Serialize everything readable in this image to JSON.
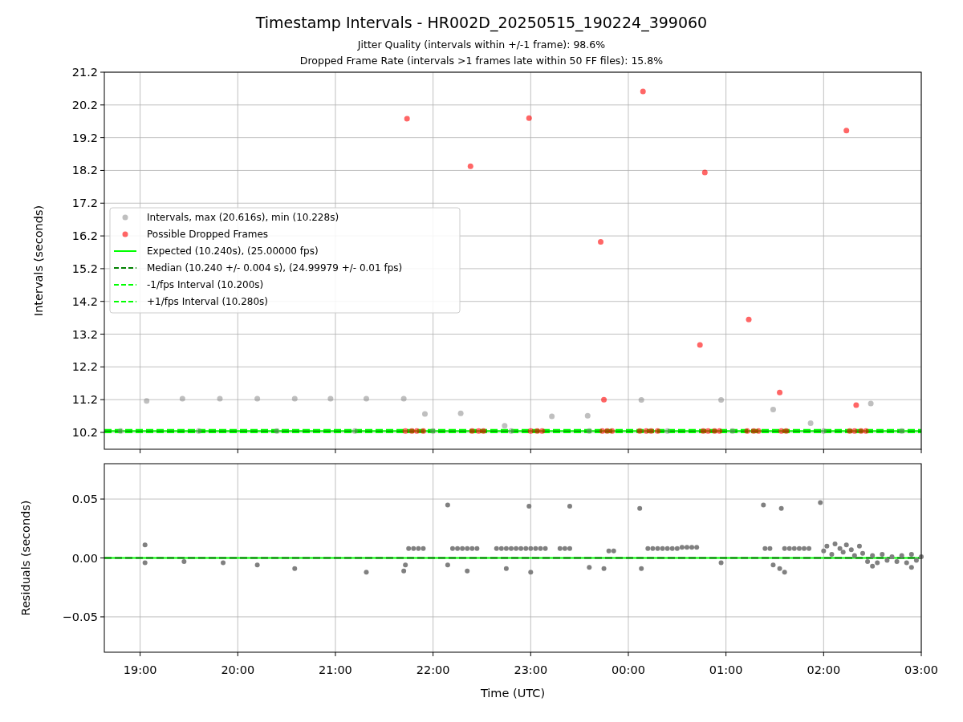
{
  "title": "Timestamp Intervals - HR002D_20250515_190224_399060",
  "subtitles": [
    "Jitter Quality (intervals within +/-1 frame): 98.6%",
    "Dropped Frame Rate (intervals >1 frames late within 50 FF files): 15.8%"
  ],
  "intervals_chart": {
    "chart_data": {
      "type": "scatter",
      "ylabel": "Intervals (seconds)",
      "grid": true,
      "xlim": [
        "2025-05-15 18:38",
        "2025-05-16 03:00"
      ],
      "ylim": [
        9.685,
        21.2
      ],
      "yticks": [
        {
          "value": 10.2,
          "label": "10.2"
        },
        {
          "value": 11.2,
          "label": "11.2"
        },
        {
          "value": 12.2,
          "label": "12.2"
        },
        {
          "value": 13.2,
          "label": "13.2"
        },
        {
          "value": 14.2,
          "label": "14.2"
        },
        {
          "value": 15.2,
          "label": "15.2"
        },
        {
          "value": 16.2,
          "label": "16.2"
        },
        {
          "value": 17.2,
          "label": "17.2"
        },
        {
          "value": 18.2,
          "label": "18.2"
        },
        {
          "value": 19.2,
          "label": "19.2"
        },
        {
          "value": 20.2,
          "label": "20.2"
        },
        {
          "value": 21.2,
          "label": "21.2"
        }
      ],
      "series": [
        {
          "name": "Intervals, max (20.616s), min (10.228s)",
          "color": "#808080",
          "x": [
            "2025-05-15 18:48",
            "2025-05-15 19:36",
            "2025-05-15 20:24",
            "2025-05-15 21:12",
            "2025-05-15 22:00",
            "2025-05-15 22:48",
            "2025-05-15 23:36",
            "2025-05-16 00:24",
            "2025-05-16 01:04",
            "2025-05-16 02:00",
            "2025-05-16 02:48",
            "2025-05-15 19:04",
            "2025-05-15 19:26",
            "2025-05-15 19:49",
            "2025-05-15 20:12",
            "2025-05-15 20:35",
            "2025-05-15 20:57",
            "2025-05-15 21:19",
            "2025-05-15 21:42",
            "2025-05-15 21:55",
            "2025-05-15 22:17",
            "2025-05-15 22:44",
            "2025-05-15 23:13",
            "2025-05-15 23:35",
            "2025-05-16 00:08",
            "2025-05-16 00:57",
            "2025-05-16 01:29",
            "2025-05-16 01:52",
            "2025-05-16 02:29"
          ],
          "values": [
            10.24,
            10.24,
            10.24,
            10.24,
            10.24,
            10.24,
            10.24,
            10.24,
            10.24,
            10.24,
            10.24,
            11.16,
            11.23,
            11.23,
            11.23,
            11.23,
            11.23,
            11.23,
            11.23,
            10.76,
            10.78,
            10.4,
            10.69,
            10.71,
            11.19,
            11.19,
            10.9,
            10.48,
            11.08
          ]
        },
        {
          "name": "Possible Dropped Frames",
          "color": "#ff0000",
          "x": [
            "2025-05-15 21:44",
            "2025-05-15 22:23",
            "2025-05-15 22:59",
            "2025-05-15 23:43",
            "2025-05-15 23:45",
            "2025-05-16 00:09",
            "2025-05-16 00:44",
            "2025-05-16 00:47",
            "2025-05-16 01:14",
            "2025-05-16 01:33",
            "2025-05-16 02:14",
            "2025-05-16 02:20",
            "2025-05-15 21:43",
            "2025-05-15 21:47",
            "2025-05-15 21:50",
            "2025-05-15 21:54",
            "2025-05-15 22:24",
            "2025-05-15 22:28",
            "2025-05-15 22:31",
            "2025-05-15 23:00",
            "2025-05-15 23:04",
            "2025-05-15 23:07",
            "2025-05-15 23:44",
            "2025-05-15 23:47",
            "2025-05-15 23:50",
            "2025-05-16 00:07",
            "2025-05-16 00:11",
            "2025-05-16 00:14",
            "2025-05-16 00:18",
            "2025-05-16 00:46",
            "2025-05-16 00:49",
            "2025-05-16 00:53",
            "2025-05-16 00:56",
            "2025-05-16 01:13",
            "2025-05-16 01:17",
            "2025-05-16 01:20",
            "2025-05-16 01:34",
            "2025-05-16 01:37",
            "2025-05-16 02:16",
            "2025-05-16 02:19",
            "2025-05-16 02:23",
            "2025-05-16 02:26"
          ],
          "values": [
            19.78,
            18.33,
            19.8,
            16.02,
            11.2,
            20.61,
            12.87,
            18.14,
            13.65,
            11.42,
            19.42,
            11.03,
            10.24,
            10.24,
            10.24,
            10.24,
            10.24,
            10.24,
            10.24,
            10.24,
            10.24,
            10.24,
            10.24,
            10.24,
            10.24,
            10.24,
            10.24,
            10.24,
            10.24,
            10.24,
            10.24,
            10.24,
            10.24,
            10.24,
            10.24,
            10.24,
            10.24,
            10.24,
            10.24,
            10.24,
            10.24,
            10.24
          ]
        }
      ],
      "ref_lines": [
        {
          "axis": "y",
          "value": 10.24,
          "label": "Expected (10.240s), (25.00000 fps)",
          "color": "#00ff00"
        },
        {
          "axis": "y",
          "value": 10.24,
          "label": "Median (10.240 +/- 0.004 s), (24.99979 +/- 0.01 fps)",
          "color": "#008000"
        },
        {
          "axis": "y",
          "value": 10.2,
          "label": "-1/fps Interval (10.200s)",
          "color": "#00ff00"
        },
        {
          "axis": "y",
          "value": 10.28,
          "label": "+1/fps Interval (10.280s)",
          "color": "#00ff00"
        }
      ],
      "legend": "center left"
    }
  },
  "residuals_chart": {
    "chart_data": {
      "type": "scatter",
      "xlabel": "Time (UTC)",
      "ylabel": "Residuals (seconds)",
      "grid": true,
      "xlim": [
        "2025-05-15 18:38",
        "2025-05-16 03:00"
      ],
      "ylim": [
        -0.08,
        0.08
      ],
      "xticks": [
        {
          "value": "2025-05-15 19:00",
          "label": "19:00"
        },
        {
          "value": "2025-05-15 20:00",
          "label": "20:00"
        },
        {
          "value": "2025-05-15 21:00",
          "label": "21:00"
        },
        {
          "value": "2025-05-15 22:00",
          "label": "22:00"
        },
        {
          "value": "2025-05-15 23:00",
          "label": "23:00"
        },
        {
          "value": "2025-05-16 00:00",
          "label": "00:00"
        },
        {
          "value": "2025-05-16 01:00",
          "label": "01:00"
        },
        {
          "value": "2025-05-16 02:00",
          "label": "02:00"
        },
        {
          "value": "2025-05-16 03:00",
          "label": "03:00"
        }
      ],
      "yticks": [
        {
          "value": -0.05,
          "label": "−0.05"
        },
        {
          "value": 0,
          "label": "0.00"
        },
        {
          "value": 0.05,
          "label": "0.05"
        }
      ],
      "series": [
        {
          "color": "#808080",
          "x": [
            "2025-05-15 19:03",
            "2025-05-15 19:03",
            "2025-05-15 19:27",
            "2025-05-15 19:51",
            "2025-05-15 20:12",
            "2025-05-15 20:35",
            "2025-05-15 21:19",
            "2025-05-15 21:42",
            "2025-05-15 21:43",
            "2025-05-15 21:45",
            "2025-05-15 21:48",
            "2025-05-15 21:51",
            "2025-05-15 21:54",
            "2025-05-15 22:12",
            "2025-05-15 22:15",
            "2025-05-15 22:18",
            "2025-05-15 22:21",
            "2025-05-15 22:24",
            "2025-05-15 22:27",
            "2025-05-15 22:39",
            "2025-05-15 22:42",
            "2025-05-15 22:45",
            "2025-05-15 22:48",
            "2025-05-15 22:51",
            "2025-05-15 22:54",
            "2025-05-15 22:57",
            "2025-05-15 23:00",
            "2025-05-15 23:03",
            "2025-05-15 23:06",
            "2025-05-15 23:09",
            "2025-05-15 23:18",
            "2025-05-15 23:21",
            "2025-05-15 23:24",
            "2025-05-15 23:48",
            "2025-05-15 23:51",
            "2025-05-16 00:12",
            "2025-05-16 00:15",
            "2025-05-16 00:18",
            "2025-05-16 00:21",
            "2025-05-16 00:24",
            "2025-05-16 00:27",
            "2025-05-16 00:30",
            "2025-05-16 00:33",
            "2025-05-16 00:36",
            "2025-05-16 00:39",
            "2025-05-16 00:42",
            "2025-05-16 01:24",
            "2025-05-16 01:27",
            "2025-05-16 01:36",
            "2025-05-16 01:39",
            "2025-05-16 01:42",
            "2025-05-16 01:45",
            "2025-05-16 01:48",
            "2025-05-16 01:51",
            "2025-05-16 02:00",
            "2025-05-16 02:02",
            "2025-05-16 02:05",
            "2025-05-16 02:07",
            "2025-05-16 02:10",
            "2025-05-16 02:12",
            "2025-05-16 02:14",
            "2025-05-16 02:17",
            "2025-05-16 02:19",
            "2025-05-16 02:22",
            "2025-05-16 02:24",
            "2025-05-16 02:27",
            "2025-05-16 02:30",
            "2025-05-16 02:33",
            "2025-05-16 02:36",
            "2025-05-16 02:39",
            "2025-05-16 02:42",
            "2025-05-16 02:45",
            "2025-05-16 02:48",
            "2025-05-16 02:51",
            "2025-05-16 02:54",
            "2025-05-16 02:57",
            "2025-05-16 03:00",
            "2025-05-15 22:09",
            "2025-05-15 22:21",
            "2025-05-15 22:45",
            "2025-05-15 23:00",
            "2025-05-15 23:36",
            "2025-05-15 23:45",
            "2025-05-16 00:08",
            "2025-05-16 00:57",
            "2025-05-16 01:29",
            "2025-05-16 01:36",
            "2025-05-16 01:33",
            "2025-05-16 02:30",
            "2025-05-16 02:54",
            "2025-05-15 22:09",
            "2025-05-15 22:59",
            "2025-05-15 23:24",
            "2025-05-16 00:07",
            "2025-05-16 01:23",
            "2025-05-16 01:34",
            "2025-05-16 01:58"
          ],
          "values": [
            0.011,
            -0.004,
            -0.003,
            -0.004,
            -0.006,
            -0.009,
            -0.012,
            -0.011,
            -0.006,
            0.008,
            0.008,
            0.008,
            0.008,
            0.008,
            0.008,
            0.008,
            0.008,
            0.008,
            0.008,
            0.008,
            0.008,
            0.008,
            0.008,
            0.008,
            0.008,
            0.008,
            0.008,
            0.008,
            0.008,
            0.008,
            0.008,
            0.008,
            0.008,
            0.006,
            0.006,
            0.008,
            0.008,
            0.008,
            0.008,
            0.008,
            0.008,
            0.008,
            0.009,
            0.009,
            0.009,
            0.009,
            0.008,
            0.008,
            0.008,
            0.008,
            0.008,
            0.008,
            0.008,
            0.008,
            0.006,
            0.01,
            0.003,
            0.012,
            0.008,
            0.005,
            0.011,
            0.007,
            0.002,
            0.01,
            0.004,
            -0.003,
            0.002,
            -0.004,
            0.003,
            -0.002,
            0.001,
            -0.003,
            0.002,
            -0.004,
            0.003,
            -0.002,
            0.001,
            -0.006,
            -0.011,
            -0.009,
            -0.012,
            -0.008,
            -0.009,
            -0.009,
            -0.004,
            -0.006,
            -0.012,
            -0.009,
            -0.007,
            -0.008,
            0.045,
            0.044,
            0.044,
            0.042,
            0.045,
            0.042,
            0.047
          ]
        }
      ],
      "ref_lines": [
        {
          "axis": "y",
          "value": 0,
          "color": "#00ff00"
        },
        {
          "axis": "y",
          "value": 0,
          "color": "#008000"
        }
      ]
    }
  }
}
